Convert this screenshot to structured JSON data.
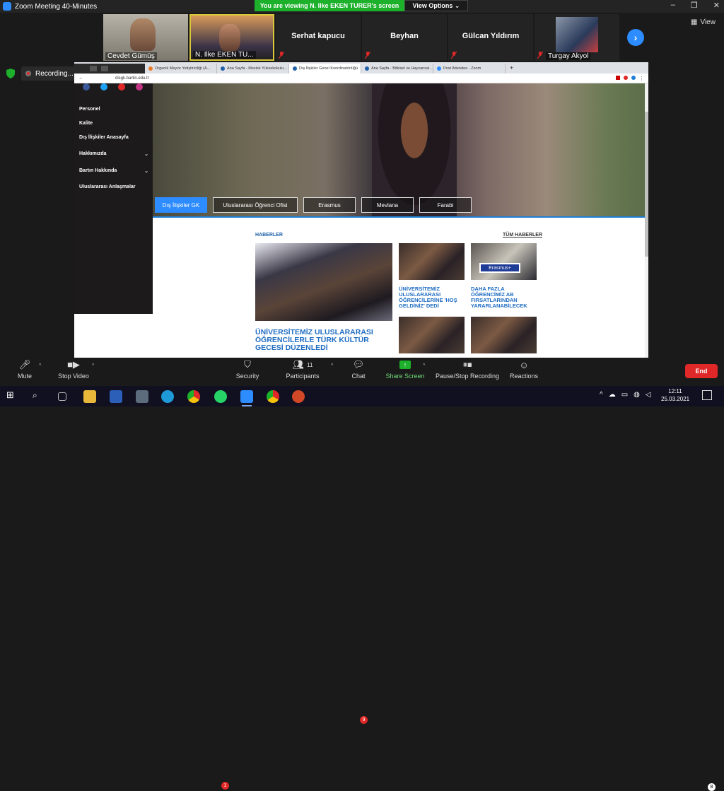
{
  "zoom": {
    "window_title": "Zoom Meeting 40-Minutes",
    "viewing_banner": "You are viewing N. Ilke EKEN TURER's screen",
    "view_options": "View Options",
    "view_label": "View",
    "recording_label": "Recording..."
  },
  "participants": [
    {
      "name": "Cevdet Gümüş",
      "has_video": true
    },
    {
      "name": "N. Ilke EKEN TU...",
      "has_video": true
    },
    {
      "name": "Serhat  kapucu",
      "has_video": false
    },
    {
      "name": "Beyhan",
      "has_video": false
    },
    {
      "name": "Gülcan Yıldırım",
      "has_video": false
    },
    {
      "name": "Turgay Akyol",
      "has_video": true
    }
  ],
  "browser": {
    "tabs": [
      "Organik Meyve Yetiştiriciliği (A...",
      "Ana Sayfa - Meslek Yüksekokulu...",
      "Dış İlişkiler Genel Koordinatörlüğü",
      "Ana Sayfa - Bitkisel ve Hayvansal...",
      "Post Attendee - Zoom"
    ],
    "url": "disgk.bartin.edu.tr"
  },
  "site": {
    "sidebar_items": [
      {
        "label": "Personel",
        "expandable": false
      },
      {
        "label": "Kalite",
        "expandable": false
      },
      {
        "label": "Dış İlişkiler Anasayfa",
        "expandable": false
      },
      {
        "label": "Hakkımızda",
        "expandable": true
      },
      {
        "label": "Bartın Hakkında",
        "expandable": true
      },
      {
        "label": "Uluslararası Anlaşmalar",
        "expandable": false
      }
    ],
    "hero_tabs": [
      "Dış İlişkiler GK",
      "Uluslararası Öğrenci Ofisi",
      "Erasmus",
      "Mevlana",
      "Farabi"
    ],
    "news_label": "HABERLER",
    "all_news": "TÜM HABERLER",
    "main_news_title": "ÜNİVERSİTEMİZ ULUSLARARASI ÖĞRENCİLERLE TÜRK KÜLTÜR GECESİ DÜZENLEDİ",
    "news_titles": [
      "ÜNİVERSİTEMİZ ULUSLARARASI ÖĞRENCİLERİNE 'HOŞ GELDİNİZ' DEDİ",
      "DAHA FAZLA ÖĞRENCİMİZ AB FIRSATLARINDAN YARARLANABİLECEK"
    ],
    "erasmus_logo": "Erasmus+"
  },
  "toolbar": {
    "mute": "Mute",
    "stop_video": "Stop Video",
    "security": "Security",
    "participants": "Participants",
    "participants_count": "11",
    "chat": "Chat",
    "chat_badge": "9",
    "share_screen": "Share Screen",
    "stop_recording": "Pause/Stop Recording",
    "reactions": "Reactions",
    "end": "End"
  },
  "taskbar": {
    "time": "12:11",
    "date": "25.03.2021",
    "notification_count": "8",
    "whatsapp_badge": "1"
  }
}
